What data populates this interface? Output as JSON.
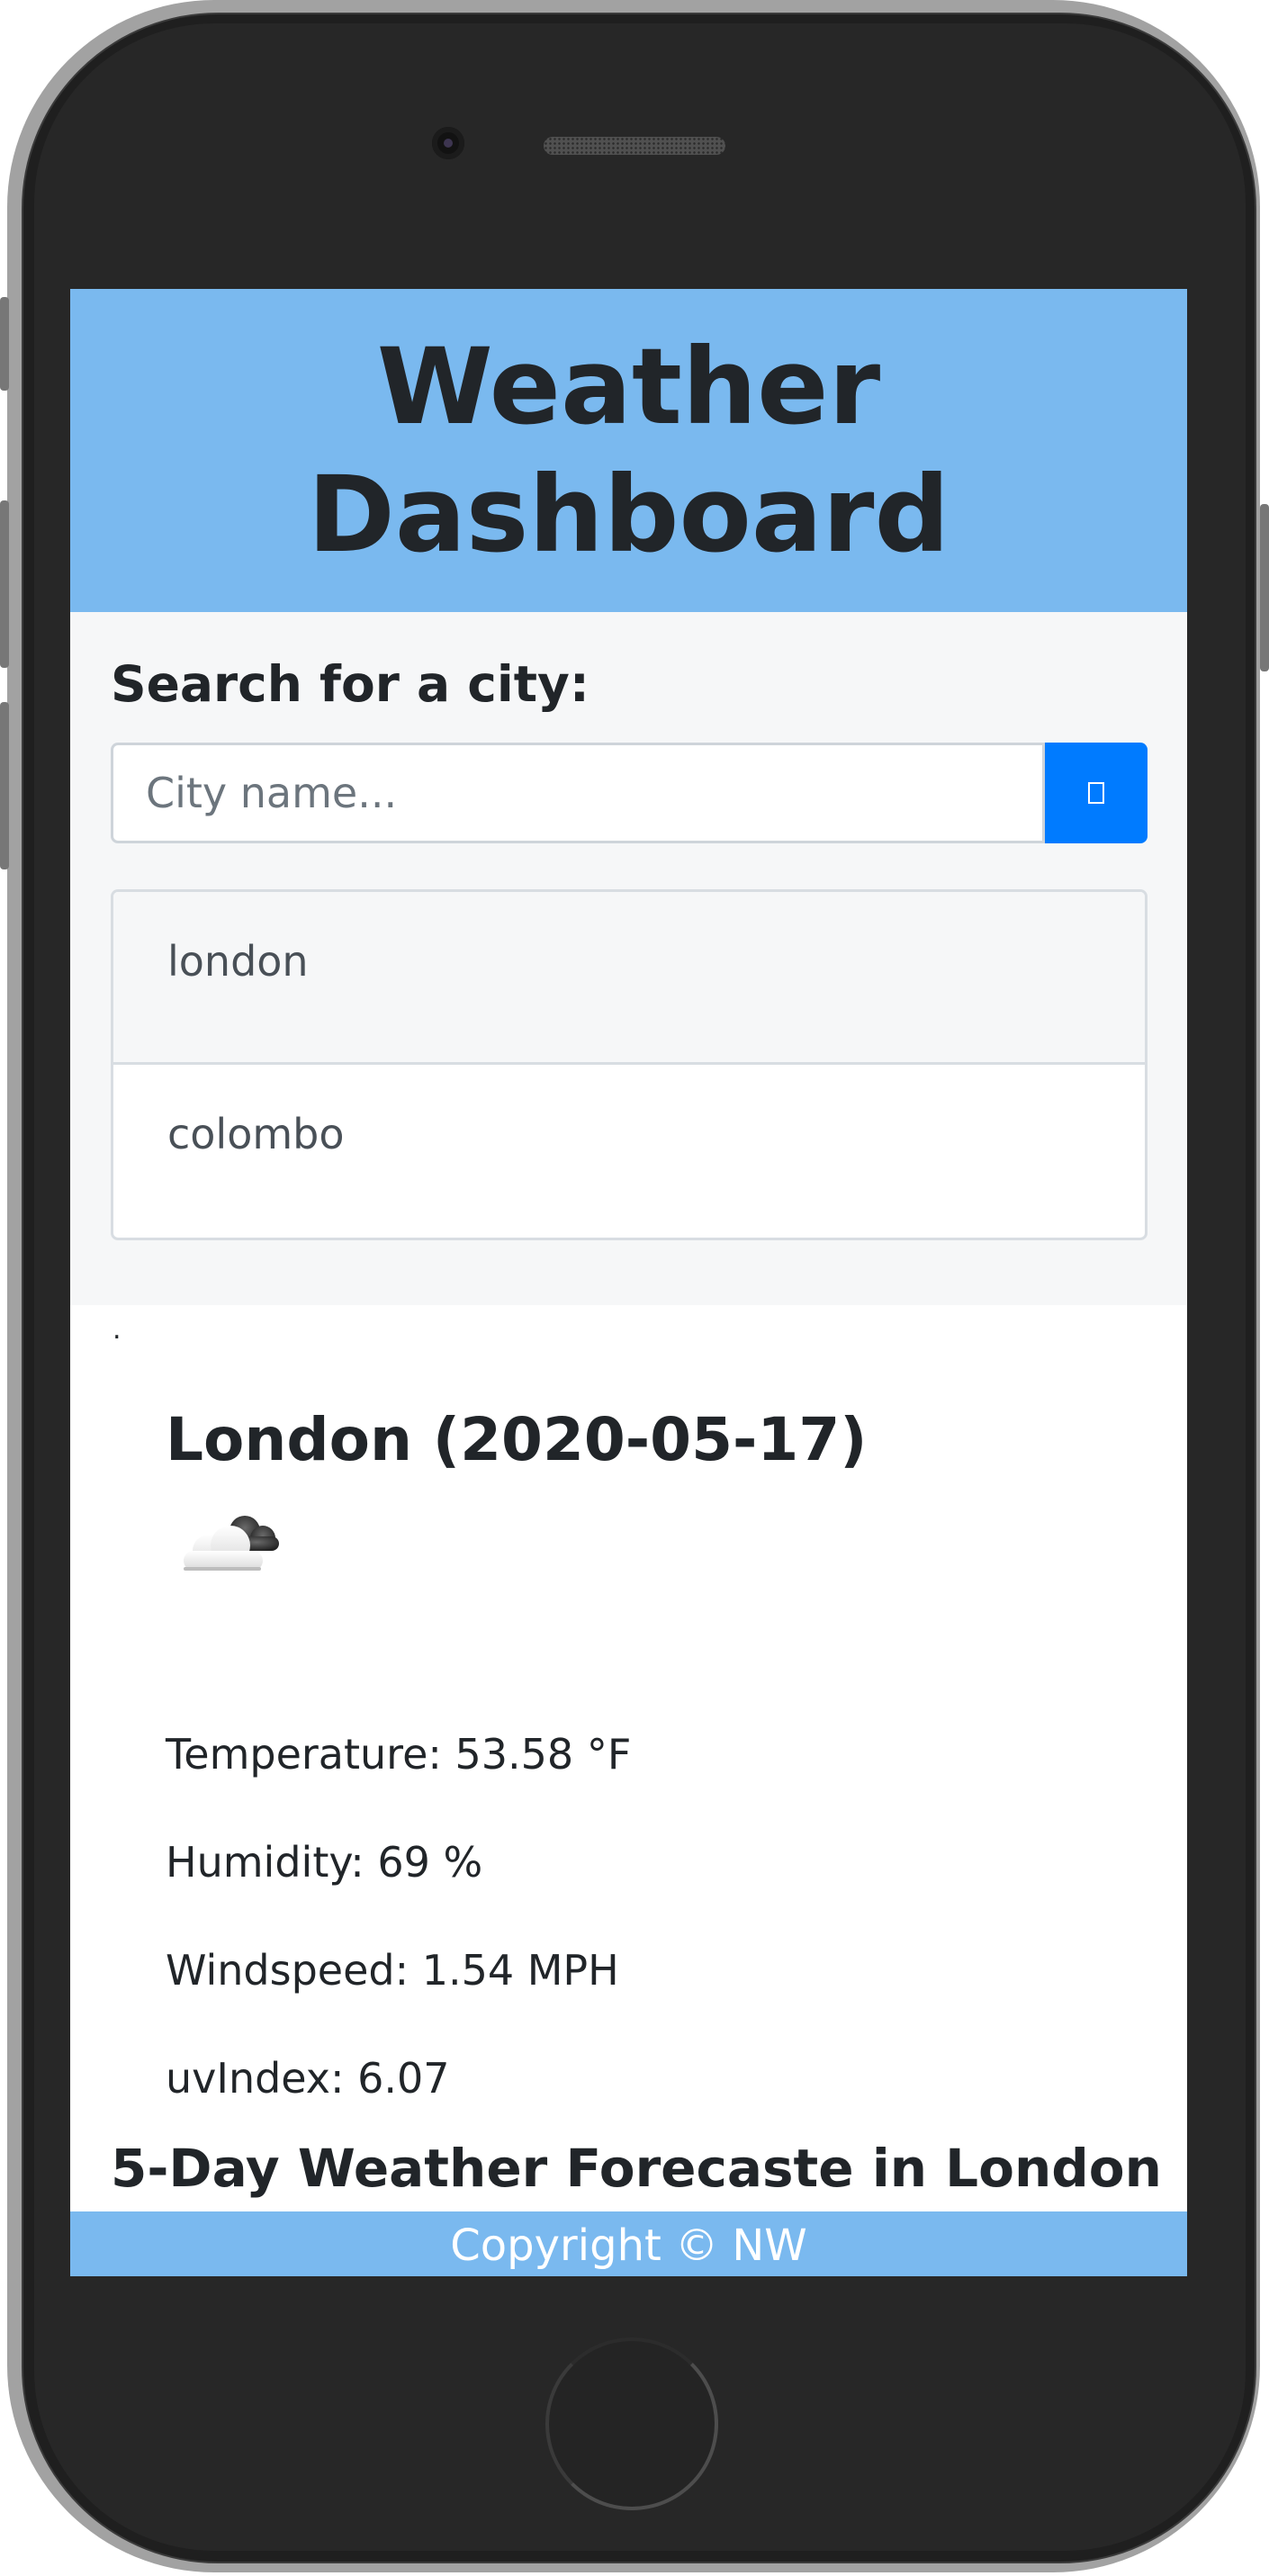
{
  "header": {
    "title": "Weather Dashboard"
  },
  "search": {
    "label": "Search for a city:",
    "placeholder": "City name...",
    "button_icon": "search-icon"
  },
  "history": [
    "london",
    "colombo"
  ],
  "separator": ".",
  "current": {
    "title": "London (2020-05-17)",
    "icon": "partly-cloudy-icon",
    "temperature": "Temperature: 53.58 °F",
    "humidity": "Humidity: 69 %",
    "windspeed": "Windspeed: 1.54 MPH",
    "uv_index": "uvIndex: 6.07"
  },
  "forecast": {
    "title": "5-Day Weather Forecaste in London"
  },
  "footer": {
    "text": "Copyright © NW"
  },
  "colors": {
    "header_bg": "#7ab9ef",
    "button_bg": "#007bff",
    "panel_bg": "#f6f7f8"
  }
}
